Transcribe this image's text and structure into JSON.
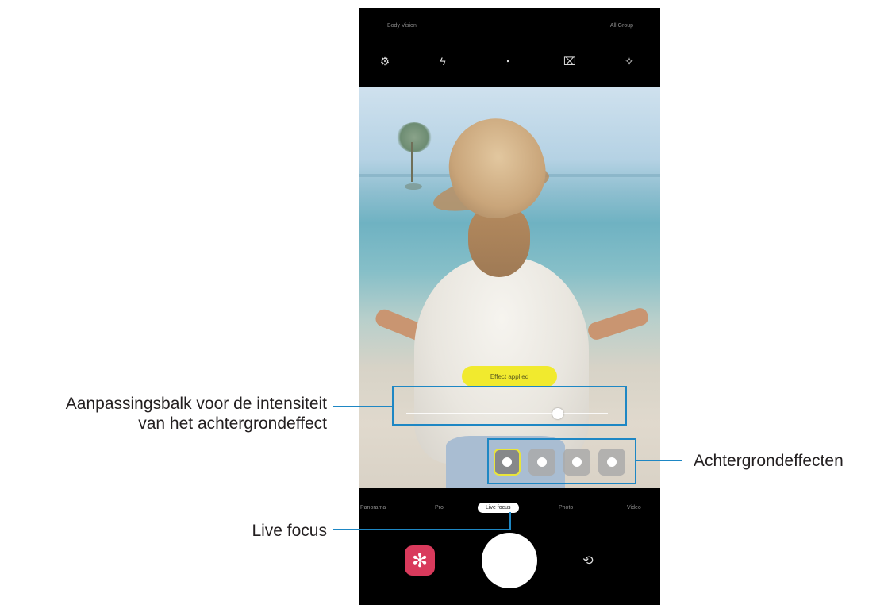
{
  "status_bar": {
    "left": "Body Vision",
    "right": "All Group"
  },
  "top_toolbar": {
    "icons": [
      "settings-icon",
      "flash-icon",
      "timer-icon",
      "aspect-ratio-icon",
      "filter-icon"
    ],
    "glyphs": [
      "⚙",
      "ϟ",
      "◔",
      "⌧",
      "✧"
    ]
  },
  "viewfinder": {
    "effect_label": "Effect applied",
    "intensity_level": 0.75,
    "selected_effect_index": 0,
    "effects": [
      "effect-blur",
      "effect-spin",
      "effect-zoom",
      "effect-color-point"
    ],
    "accent_color": "#f1ea2e"
  },
  "modes": {
    "items": [
      "Panorama",
      "Pro",
      "Live focus",
      "Photo",
      "Video"
    ],
    "active": "Live focus"
  },
  "bottom_controls": {
    "bixby_glyph": "✻",
    "switch_glyph": "⟲"
  },
  "callouts": {
    "slider_label": "Aanpassingsbalk voor de intensiteit\nvan het achtergrondeffect",
    "effects_label": "Achtergrondeffecten",
    "livefocus_label": "Live focus",
    "color": "#1e87c4"
  }
}
